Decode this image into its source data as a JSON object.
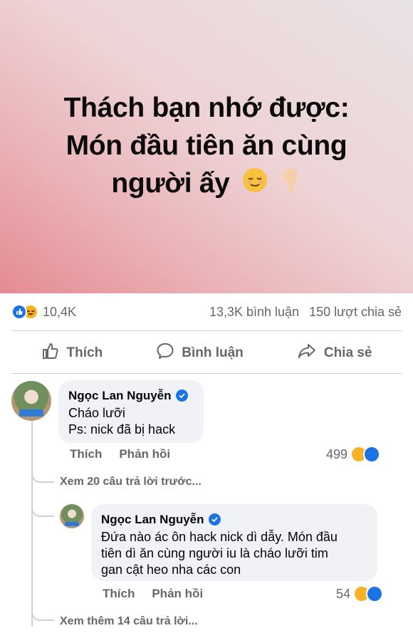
{
  "post": {
    "text_line1": "Thách bạn nhớ được:",
    "text_line2": "Món đầu tiên ăn cùng",
    "text_line3": "người ấy",
    "background_colors": [
      "#e58b93",
      "#e9e3e4"
    ]
  },
  "stats": {
    "reactions_count": "10,4K",
    "comments_count": "13,3K bình luận",
    "shares_count": "150 lượt chia sẻ"
  },
  "actions": {
    "like_label": "Thích",
    "comment_label": "Bình luận",
    "share_label": "Chia sẻ"
  },
  "comments": [
    {
      "author": "Ngọc Lan Nguyễn",
      "line1": "Cháo lưỡi",
      "line2": "Ps: nick đã bị hack",
      "like_label": "Thích",
      "reply_label": "Phản hồi",
      "reactions": "499"
    }
  ],
  "view_previous": "Xem 20 câu trả lời trước...",
  "reply": {
    "author": "Ngọc Lan Nguyễn",
    "line1": "Đứa nào ác ôn hack nick dì dẫy. Món đầu",
    "line2": "tiên dì ăn cùng người iu là cháo lưỡi tim",
    "line3": "gan cật heo nha các con",
    "like_label": "Thích",
    "reply_label": "Phản hồi",
    "reactions": "54"
  },
  "view_more": "Xem thêm 14 câu trả lời...",
  "colors": {
    "accent": "#1b74e4",
    "muted": "#65676b",
    "bubble": "#f0f2f5"
  }
}
